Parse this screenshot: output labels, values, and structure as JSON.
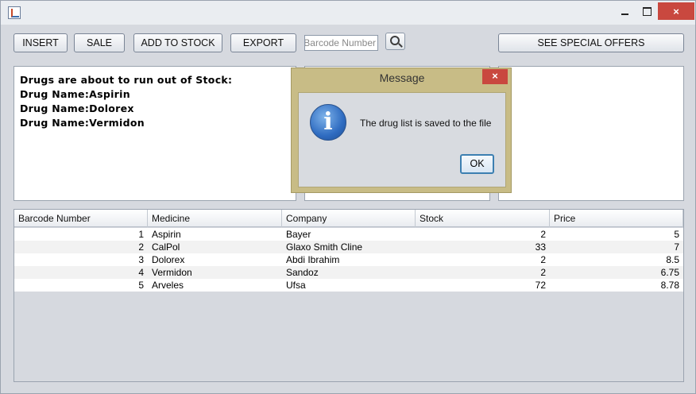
{
  "window": {
    "title": "",
    "controls": {
      "close": "×"
    }
  },
  "toolbar": {
    "insert_label": "INSERT",
    "sale_label": "SALE",
    "add_to_stock_label": "ADD TO STOCK",
    "export_label": "EXPORT",
    "search_placeholder": "Barcode Number",
    "special_offers_label": "SEE SPECIAL OFFERS"
  },
  "stock_alert": {
    "heading": "Drugs are about to run out of Stock:",
    "lines": [
      "Drug Name:Aspirin",
      "Drug Name:Dolorex",
      "Drug Name:Vermidon"
    ]
  },
  "table": {
    "columns": [
      "Barcode Number",
      "Medicine",
      "Company",
      "Stock",
      "Price"
    ],
    "rows": [
      [
        "1",
        "Aspirin",
        "Bayer",
        "2",
        "5"
      ],
      [
        "2",
        "CalPol",
        "Glaxo Smith Cline",
        "33",
        "7"
      ],
      [
        "3",
        "Dolorex",
        "Abdi Ibrahim",
        "2",
        "8.5"
      ],
      [
        "4",
        "Vermidon",
        "Sandoz",
        "2",
        "6.75"
      ],
      [
        "5",
        "Arveles",
        "Ufsa",
        "72",
        "8.78"
      ]
    ]
  },
  "dialog": {
    "title": "Message",
    "message": "The drug list is saved to the file",
    "ok_label": "OK",
    "close_label": "×",
    "icon": "information-icon",
    "icon_glyph": "i"
  },
  "colors": {
    "dialog_frame": "#c8bc86",
    "close_button": "#c9483f",
    "info_icon": "#2f6cc1"
  }
}
